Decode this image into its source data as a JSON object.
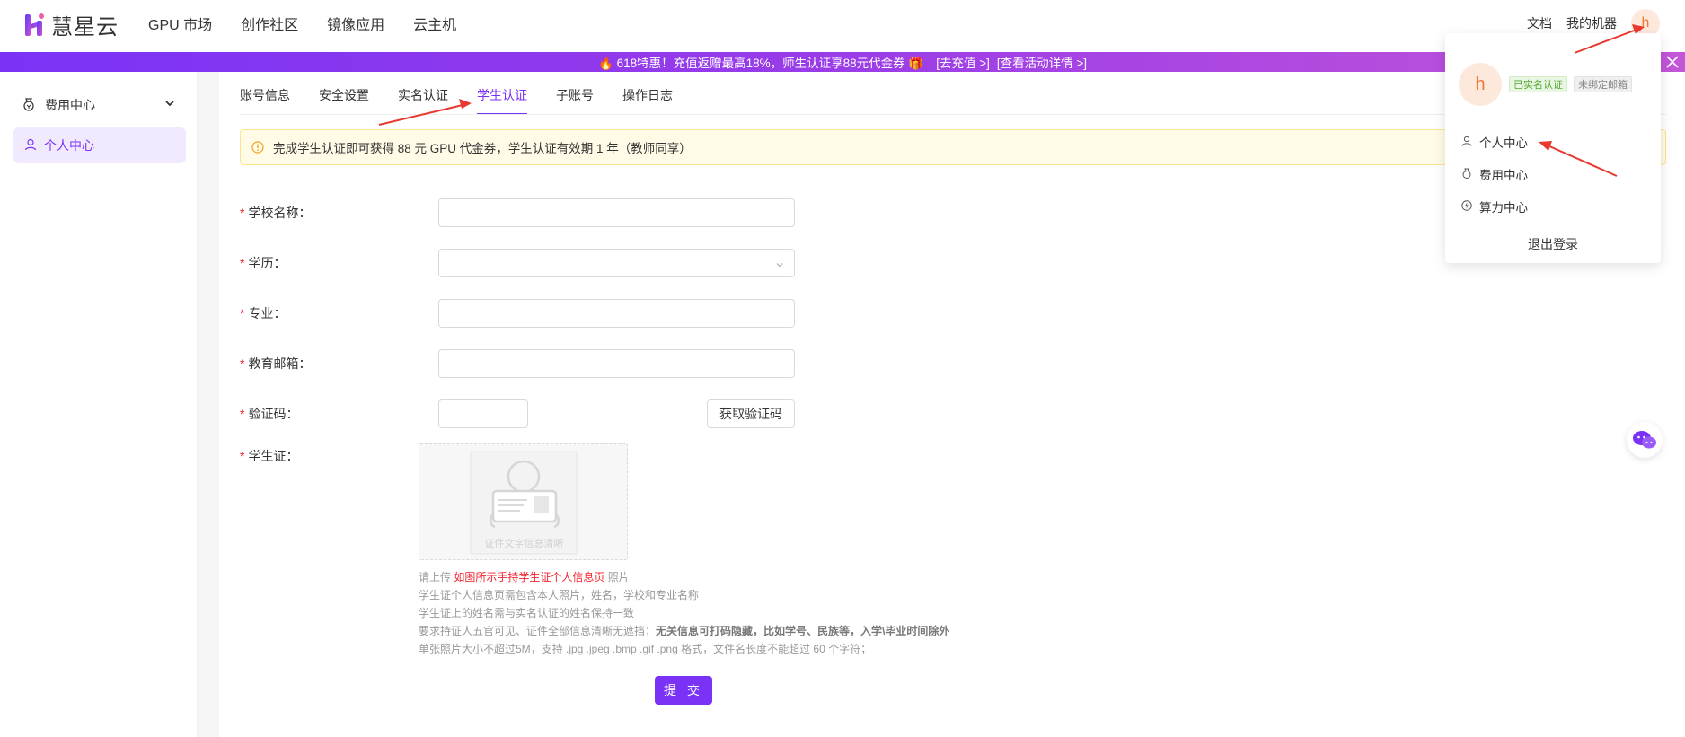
{
  "brand": {
    "name": "慧星云",
    "accent": "#7a33f6"
  },
  "topnav": {
    "links": [
      "GPU 市场",
      "创作社区",
      "镜像应用",
      "云主机"
    ],
    "right_links": [
      "文档",
      "我的机器"
    ],
    "avatar_letter": "h"
  },
  "promo": {
    "text": "🔥 618特惠！充值返赠最高18%，师生认证享88元代金券 🎁",
    "link1": "[去充值 >]",
    "link2": "[查看活动详情 >]"
  },
  "sidebar": {
    "group_label": "费用中心",
    "active_label": "个人中心"
  },
  "tabs": [
    "账号信息",
    "安全设置",
    "实名认证",
    "学生认证",
    "子账号",
    "操作日志"
  ],
  "notice": "完成学生认证即可获得 88 元 GPU 代金券，学生认证有效期 1 年（教师同享）",
  "form": {
    "school_label": "学校名称：",
    "degree_label": "学历：",
    "major_label": "专业：",
    "email_label": "教育邮箱：",
    "code_label": "验证码：",
    "get_code": "获取验证码",
    "card_label": "学生证：",
    "upload_caption": "证件文字信息清晰",
    "submit": "提 交"
  },
  "hints": {
    "line1_prefix": "请上传 ",
    "line1_highlight": "如图所示手持学生证个人信息页",
    "line1_suffix": " 照片",
    "line2": "学生证个人信息页需包含本人照片，姓名，学校和专业名称",
    "line3": "学生证上的姓名需与实名认证的姓名保持一致",
    "line4_prefix": "要求持证人五官可见、证件全部信息清晰无遮挡；",
    "line4_bold": "无关信息可打码隐藏，比如学号、民族等，入学\\毕业时间除外",
    "line5": "单张照片大小不超过5M，支持 .jpg .jpeg .bmp .gif .png 格式，文件名长度不能超过 60 个字符；"
  },
  "dropdown": {
    "avatar_letter": "h",
    "badge_verified": "已实名认证",
    "badge_email": "未绑定邮箱",
    "items": [
      "个人中心",
      "费用中心",
      "算力中心"
    ],
    "logout": "退出登录"
  }
}
